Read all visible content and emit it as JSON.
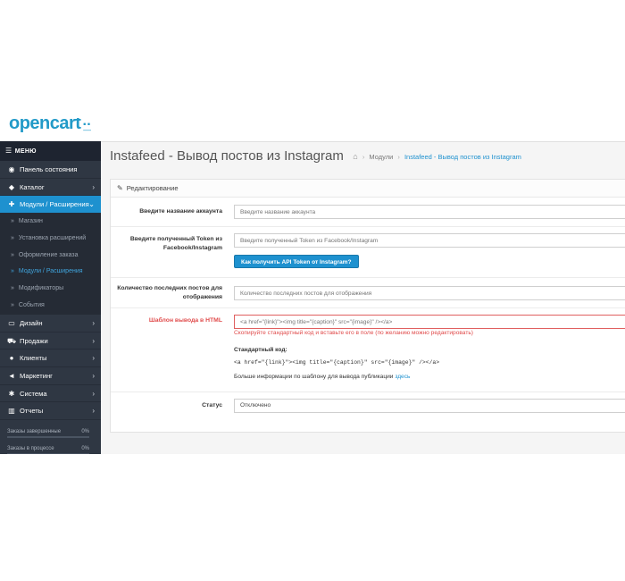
{
  "header": {
    "logo_text": "opencart",
    "logo_suffix": "·̲·"
  },
  "sidebar": {
    "menu_title": "МЕНЮ",
    "items": [
      {
        "label": "Панель состояния",
        "icon": "dashboard-icon",
        "chevron": false
      },
      {
        "label": "Каталог",
        "icon": "tag-icon",
        "chevron": true
      },
      {
        "label": "Модули / Расширения",
        "icon": "puzzle-icon",
        "chevron": true,
        "active": true
      }
    ],
    "subitems": [
      {
        "label": "Магазин"
      },
      {
        "label": "Установка расширений"
      },
      {
        "label": "Оформление заказа"
      },
      {
        "label": "Модули / Расширения",
        "current": true
      },
      {
        "label": "Модификаторы"
      },
      {
        "label": "События"
      }
    ],
    "items_after": [
      {
        "label": "Дизайн",
        "icon": "monitor-icon",
        "chevron": true
      },
      {
        "label": "Продажи",
        "icon": "cart-icon",
        "chevron": true
      },
      {
        "label": "Клиенты",
        "icon": "user-icon",
        "chevron": true
      },
      {
        "label": "Маркетинг",
        "icon": "share-icon",
        "chevron": true
      },
      {
        "label": "Система",
        "icon": "gear-icon",
        "chevron": true
      },
      {
        "label": "Отчеты",
        "icon": "bar-chart-icon",
        "chevron": true
      }
    ],
    "stats": [
      {
        "label": "Заказы завершенные",
        "value": "0%",
        "fraction": 0
      },
      {
        "label": "Заказы в процессе",
        "value": "0%",
        "fraction": 0
      }
    ]
  },
  "page": {
    "title": "Instafeed - Вывод постов из Instagram",
    "breadcrumbs": [
      "Модули",
      "Instafeed - Вывод постов из Instagram"
    ]
  },
  "panel": {
    "title": "Редактирование",
    "account": {
      "label": "Введите название аккаунта",
      "placeholder": "Введите название аккаунта"
    },
    "token": {
      "label_line1": "Введите полученный Token из",
      "label_line2": "Facebook/Instagram",
      "placeholder": "Введите полученный Token из Facebook/Instagram",
      "button": "Как получить API Token от Instagram?"
    },
    "count": {
      "label_line1": "Количество последних постов для",
      "label_line2": "отображения",
      "placeholder": "Количество последних постов для отображения"
    },
    "template": {
      "label": "Шаблон вывода в HTML",
      "value": "<a href=\"{link}\"><img title=\"{caption}\" src=\"{image}\" /></a>",
      "error": "Скопируйте стандартный код и вставьте его в поле (по желанию можно редактировать)",
      "std_label": "Стандартный код:",
      "std_code": "<a href=\"{link}\"><img title=\"{caption}\" src=\"{image}\" /></a>",
      "info_text": "Больше информации по шаблону для вывода публикации ",
      "info_link": "здесь"
    },
    "status": {
      "label": "Статус",
      "value": "Отключено"
    }
  }
}
